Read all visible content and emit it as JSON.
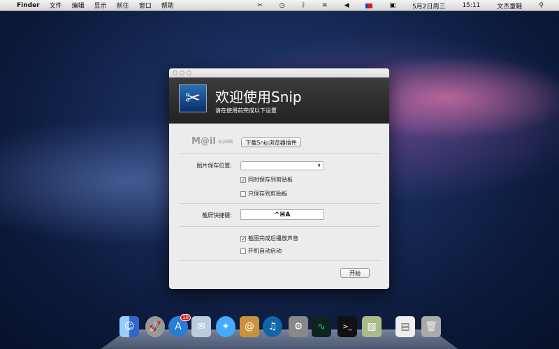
{
  "menubar": {
    "apple": "",
    "app": "Finder",
    "items": [
      "文件",
      "编辑",
      "显示",
      "前往",
      "窗口",
      "帮助"
    ],
    "date": "5月2日周三",
    "time": "15:11",
    "user": "文杰童鞋",
    "search": "⚲"
  },
  "dialog": {
    "title": "欢迎使用Snip",
    "subtitle": "请在使用前完成以下设置",
    "mail_logo": "M@il",
    "mail_sub": "QQ邮箱",
    "download_button": "下载Snip浏览器插件",
    "save_location_label": "图片保存位置:",
    "save_location_value": "",
    "opt_save_clipboard_too": {
      "label": "同时保存到剪贴板",
      "checked": true
    },
    "opt_clipboard_only": {
      "label": "只保存到剪贴板",
      "checked": false
    },
    "shortcut_label": "截屏快捷键:",
    "shortcut_value": "^⌘A",
    "opt_play_sound": {
      "label": "截图完成后播放声音",
      "checked": true
    },
    "opt_launch_login": {
      "label": "开机自动启动",
      "checked": false
    },
    "start_button": "开始"
  },
  "dock": {
    "appstore_badge": "10"
  }
}
